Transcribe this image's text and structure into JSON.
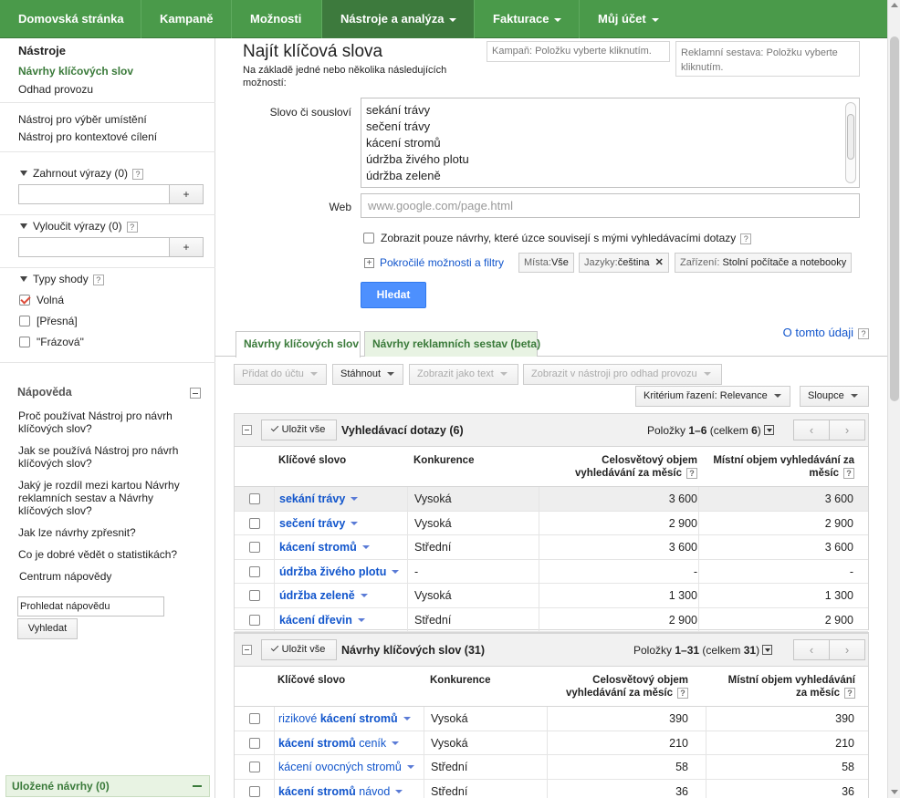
{
  "nav": [
    "Domovská stránka",
    "Kampaně",
    "Možnosti",
    "Nástroje a analýza",
    "Fakturace",
    "Můj účet"
  ],
  "sidebar": {
    "title": "Nástroje",
    "links": [
      "Návrhy klíčových slov",
      "Odhad provozu"
    ],
    "links2": [
      "Nástroj pro výběr umístění",
      "Nástroj pro kontextové cílení"
    ],
    "include": "Zahrnout výrazy (0)",
    "exclude": "Vyloučit výrazy (0)",
    "plus": "+",
    "match_types": "Typy shody",
    "match": [
      "Volná",
      "[Přesná]",
      "\"Frázová\""
    ],
    "help_title": "Nápověda",
    "help": [
      "Proč používat Nástroj pro návrh klíčových slov?",
      "Jak se používá Nástroj pro návrh klíčových slov?",
      "Jaký je rozdíl mezi kartou Návrhy reklamních sestav a Návrhy klíčových slov?",
      "Jak lze návrhy zpřesnit?",
      "Co je dobré vědět o statistikách?",
      "Centrum nápovědy"
    ],
    "help_search": "Prohledat nápovědu",
    "search_btn": "Vyhledat",
    "saved": "Uložené návrhy (0)",
    "q": "?"
  },
  "main": {
    "title": "Najít klíčová slova",
    "subtitle": "Na základě jedné nebo několika následujících možností:",
    "campaign": "Kampaň: Položku vyberte kliknutím.",
    "adgroup": "Reklamní sestava: Položku vyberte kliknutím.",
    "word_label": "Slovo či sousloví",
    "keywords": [
      "sekání trávy",
      "sečení trávy",
      "kácení stromů",
      "údržba živého plotu",
      "údržba zeleně"
    ],
    "web_label": "Web",
    "web_placeholder": "www.google.com/page.html",
    "only_related": "Zobrazit pouze návrhy, které úzce souvisejí s mými vyhledávacími dotazy",
    "advanced": "Pokročilé možnosti a filtry",
    "chip_places_k": "Místa:",
    "chip_places_v": "Vše",
    "chip_lang_k": "Jazyky:",
    "chip_lang_v": "čeština",
    "chip_dev_k": "Zařízení:",
    "chip_dev_v": "Stolní počítače a notebooky",
    "chip_x": "✕",
    "search": "Hledat",
    "tab1": "Návrhy klíčových slov",
    "tab2": "Návrhy reklamních sestav (beta)",
    "about": "O tomto údaji",
    "tb": [
      "Přidat do účtu",
      "Stáhnout",
      "Zobrazit jako text",
      "Zobrazit v nástroji pro odhad provozu"
    ],
    "sort": "Kritérium řazení: Relevance",
    "cols": "Sloupce"
  },
  "t1": {
    "save": "Uložit vše",
    "title": "Vyhledávací dotazy (6)",
    "pager_a": "Položky ",
    "pager_b": "1–6",
    "pager_c": " (celkem ",
    "pager_d": "6",
    "pager_e": ")",
    "h_kw": "Klíčové slovo",
    "h_comp": "Konkurence",
    "h_g1": "Celosvětový objem",
    "h_g2": "vyhledávání za měsíc",
    "h_l1": "Místní objem vyhledávání za",
    "h_l2": "měsíc",
    "rows": [
      {
        "kw": "sekání trávy",
        "comp": "Vysoká",
        "g": "3 600",
        "l": "3 600"
      },
      {
        "kw": "sečení trávy",
        "comp": "Vysoká",
        "g": "2 900",
        "l": "2 900"
      },
      {
        "kw": "kácení stromů",
        "comp": "Střední",
        "g": "3 600",
        "l": "3 600"
      },
      {
        "kw": "údržba živého plotu",
        "comp": "-",
        "g": "-",
        "l": "-"
      },
      {
        "kw": "údržba zeleně",
        "comp": "Vysoká",
        "g": "1 300",
        "l": "1 300"
      },
      {
        "kw": "kácení dřevin",
        "comp": "Střední",
        "g": "2 900",
        "l": "2 900"
      }
    ]
  },
  "t2": {
    "save": "Uložit vše",
    "title": "Návrhy klíčových slov (31)",
    "pager_a": "Položky ",
    "pager_b": "1–31",
    "pager_c": " (celkem ",
    "pager_d": "31",
    "pager_e": ")",
    "h_kw": "Klíčové slovo",
    "h_comp": "Konkurence",
    "h_g1": "Celosvětový objem",
    "h_g2": "vyhledávání za měsíc",
    "h_l1": "Místní objem vyhledávání",
    "h_l2": "za měsíc",
    "rows": [
      {
        "pre": "rizikové ",
        "b": "kácení stromů",
        "post": "",
        "comp": "Vysoká",
        "g": "390",
        "l": "390"
      },
      {
        "pre": "",
        "b": "kácení stromů",
        "post": " ceník",
        "comp": "Vysoká",
        "g": "210",
        "l": "210"
      },
      {
        "pre": "kácení ovocných stromů",
        "b": "",
        "post": "",
        "comp": "Střední",
        "g": "58",
        "l": "58"
      },
      {
        "pre": "",
        "b": "kácení stromů",
        "post": " návod",
        "comp": "Střední",
        "g": "36",
        "l": "36"
      }
    ]
  }
}
